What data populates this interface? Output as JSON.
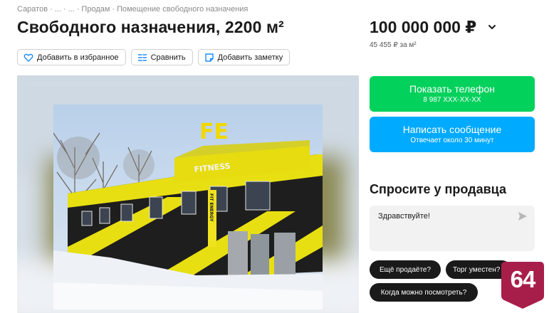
{
  "breadcrumb": {
    "items": [
      "Саратов",
      "...",
      "...",
      "Продам",
      "Помещение свободного назначения"
    ],
    "separator": "·"
  },
  "listing": {
    "title": "Свободного назначения, 2200 м²",
    "price": "100 000 000 ₽",
    "price_per_meter": "45 455 ₽ за м²"
  },
  "actions": {
    "favorite": "Добавить в избранное",
    "compare": "Сравнить",
    "note": "Добавить заметку"
  },
  "gallery": {
    "sign_top": "FE",
    "sign_main": "FITNESS",
    "sign_vertical": "FIT ENERGY"
  },
  "contact": {
    "phone_label": "Показать телефон",
    "phone_masked": "8 987 XXX-XX-XX",
    "message_label": "Написать сообщение",
    "message_sub": "Отвечает около 30 минут"
  },
  "ask": {
    "title": "Спросите у продавца",
    "input_value": "Здравствуйте!",
    "chips": [
      "Ещё продаёте?",
      "Торг уместен?",
      "Когда можно посмотреть?"
    ]
  },
  "badge": {
    "text": "64"
  },
  "colors": {
    "green": "#02d15c",
    "blue": "#00aaff",
    "badge": "#a81e4b",
    "chip": "#1a1a1a"
  }
}
